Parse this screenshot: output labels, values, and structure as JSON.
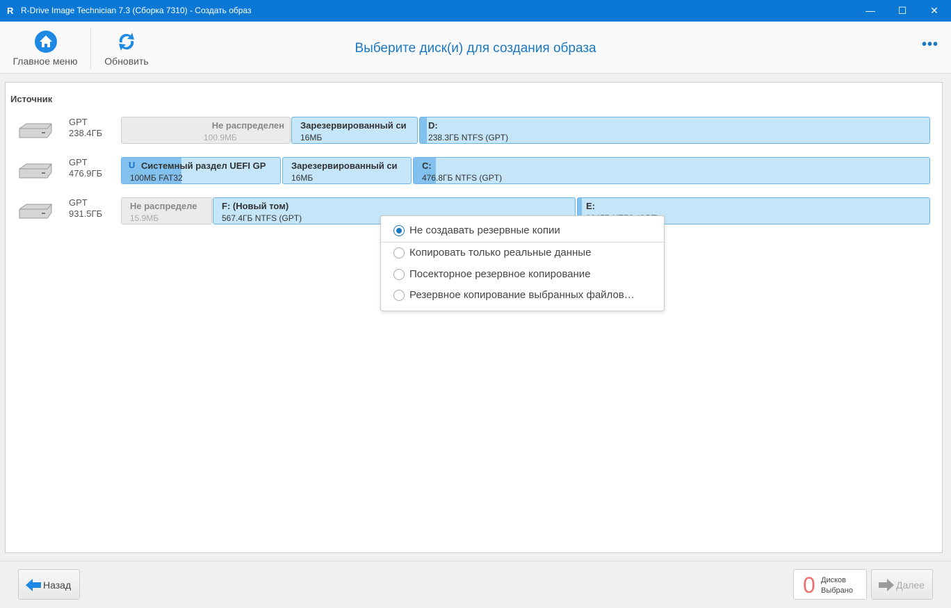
{
  "window": {
    "title": "R-Drive Image Technician 7.3 (Сборка 7310) - Создать образ",
    "logo": "R"
  },
  "toolbar": {
    "home_label": "Главное меню",
    "refresh_label": "Обновить",
    "heading": "Выберите диск(и) для создания образа",
    "more": "•••"
  },
  "source": {
    "label": "Источник",
    "disks": [
      {
        "scheme": "GPT",
        "size": "238.4ГБ",
        "partitions": [
          {
            "name": "Не распределен",
            "size": "100.9МБ",
            "type": "unallocated"
          },
          {
            "name": "Зарезервированный си",
            "size": "16МБ",
            "type": "reserved"
          },
          {
            "name": "D:",
            "size": "238.3ГБ NTFS (GPT)",
            "type": "volume"
          }
        ]
      },
      {
        "scheme": "GPT",
        "size": "476.9ГБ",
        "partitions": [
          {
            "name": "Системный раздел UEFI GP",
            "size": "100МБ FAT32",
            "type": "efi"
          },
          {
            "name": "Зарезервированный си",
            "size": "16МБ",
            "type": "reserved"
          },
          {
            "name": "C:",
            "size": "476.8ГБ NTFS (GPT)",
            "type": "volume"
          }
        ]
      },
      {
        "scheme": "GPT",
        "size": "931.5ГБ",
        "partitions": [
          {
            "name": "Не распределе",
            "size": "15.9МБ",
            "type": "unallocated"
          },
          {
            "name": "F: (Новый том)",
            "size": "567.4ГБ NTFS (GPT)",
            "type": "volume"
          },
          {
            "name": "E:",
            "size": "364ГБ NTFS (GPT)",
            "type": "volume"
          }
        ]
      }
    ]
  },
  "backup_menu": {
    "options": [
      "Не создавать резервные копии",
      "Копировать только реальные данные",
      "Посекторное резервное копирование",
      "Резервное копирование выбранных файлов…"
    ],
    "selected": 0
  },
  "footer": {
    "back_label": "Назад",
    "count": "0",
    "count_line1": "Дисков",
    "count_line2": "Выбрано",
    "next_label": "Далее"
  },
  "colors": {
    "accent": "#0a78d4",
    "partition": "#c5e6f9",
    "count": "#f07070"
  }
}
